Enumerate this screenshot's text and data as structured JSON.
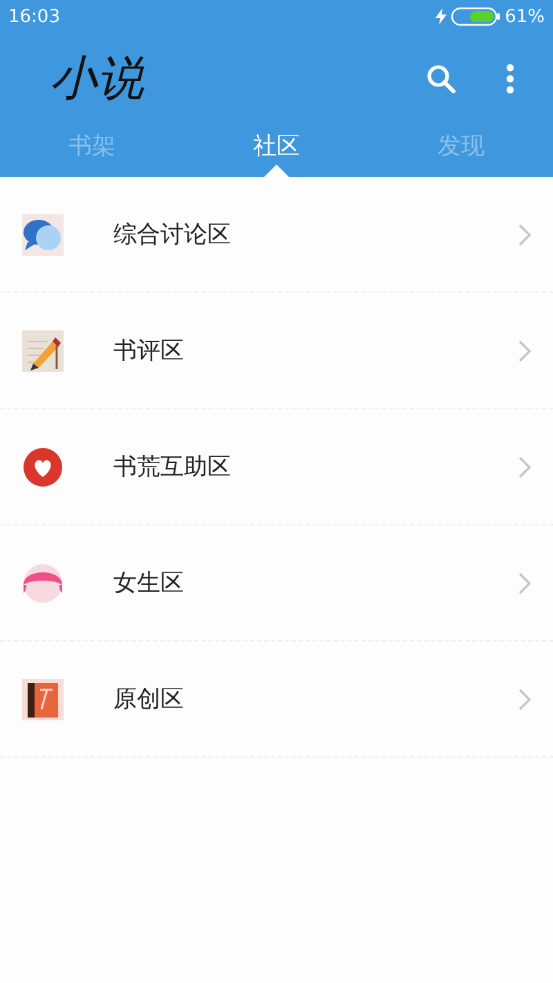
{
  "status_bar": {
    "time": "16:03",
    "battery_text": "61%"
  },
  "app_bar": {
    "title": "小说"
  },
  "tabs": [
    {
      "label": "书架",
      "selected": false
    },
    {
      "label": "社区",
      "selected": true
    },
    {
      "label": "发现",
      "selected": false
    }
  ],
  "sections": [
    {
      "kind": "chat",
      "label": "综合讨论区"
    },
    {
      "kind": "pencil",
      "label": "书评区"
    },
    {
      "kind": "heart",
      "label": "书荒互助区"
    },
    {
      "kind": "girl",
      "label": "女生区"
    },
    {
      "kind": "book",
      "label": "原创区"
    }
  ]
}
